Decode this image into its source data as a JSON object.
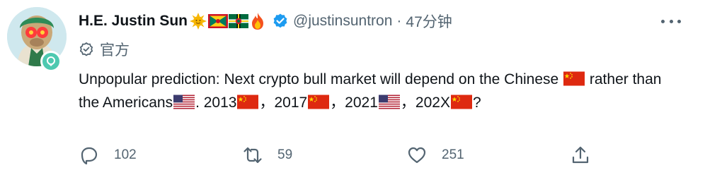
{
  "tweet": {
    "author_name": "H.E. Justin Sun",
    "name_emojis": [
      "sun-face",
      "grenada-flag",
      "dominica-flag",
      "fire"
    ],
    "verified": true,
    "handle": "@justinsuntron",
    "separator": "·",
    "time": "47分钟",
    "label": "官方",
    "text_segments": [
      {
        "text": "Unpopular prediction: Next crypto bull market will depend on the Chinese "
      },
      {
        "flag": "cn"
      },
      {
        "text": " rather than the Americans"
      },
      {
        "flag": "us"
      },
      {
        "text": ". 2013"
      },
      {
        "flag": "cn"
      },
      {
        "text": "，2017"
      },
      {
        "flag": "cn"
      },
      {
        "text": "，2021"
      },
      {
        "flag": "us"
      },
      {
        "text": "，202X"
      },
      {
        "flag": "cn"
      },
      {
        "text": "?"
      }
    ],
    "actions": {
      "reply_count": "102",
      "retweet_count": "59",
      "like_count": "251"
    }
  },
  "colors": {
    "text": "#0f1419",
    "secondary": "#536471",
    "verified_blue": "#1d9bf0",
    "background": "#ffffff"
  },
  "icons": [
    "more-icon",
    "official-badge-icon",
    "reply-icon",
    "retweet-icon",
    "like-icon",
    "share-icon",
    "verified-icon"
  ]
}
